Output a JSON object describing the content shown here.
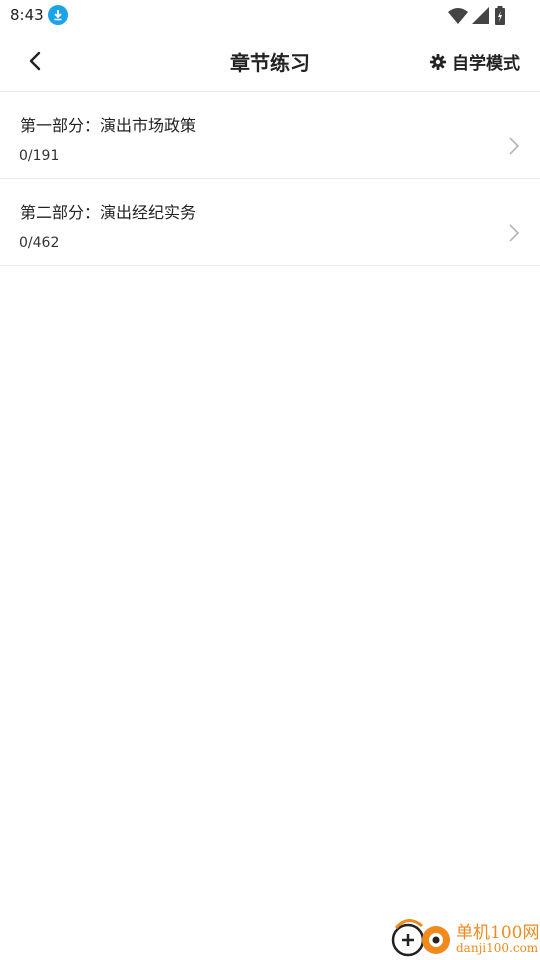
{
  "status_bar": {
    "time": "8:43",
    "icons": [
      "download-icon",
      "wifi-icon",
      "signal-icon",
      "battery-icon"
    ]
  },
  "app_bar": {
    "title": "章节练习",
    "mode_label": "自学模式",
    "icons": [
      "back-arrow-icon",
      "gear-icon"
    ]
  },
  "chapters": [
    {
      "title": "第一部分：演出市场政策",
      "progress": "0/191"
    },
    {
      "title": "第二部分：演出经纪实务",
      "progress": "0/462"
    }
  ],
  "watermark": {
    "cn": "单机100网",
    "en": "danji100.com"
  },
  "colors": {
    "accent_blue": "#1aa3e8",
    "divider": "#ececec",
    "watermark_orange": "#f08a1c"
  }
}
